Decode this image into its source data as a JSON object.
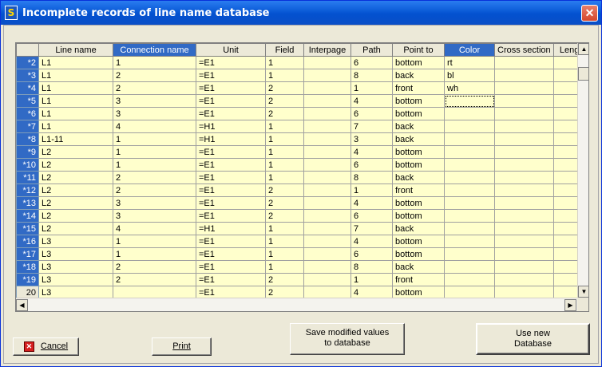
{
  "window": {
    "title": "Incomplete records of line name database",
    "icon": "app-icon",
    "close_icon": "close-icon"
  },
  "grid": {
    "columns": [
      "Line name",
      "Connection name",
      "Unit",
      "Field",
      "Interpage",
      "Path",
      "Point to",
      "Color",
      "Cross section",
      "Leng"
    ],
    "selected_columns": [
      1,
      7
    ],
    "rows": [
      {
        "num": "*2",
        "selected": true,
        "cells": [
          "L1",
          "1",
          "=E1",
          "1",
          "",
          "6",
          "bottom",
          "rt",
          "",
          ""
        ]
      },
      {
        "num": "*3",
        "selected": true,
        "cells": [
          "L1",
          "2",
          "=E1",
          "1",
          "",
          "8",
          "back",
          "bl",
          "",
          ""
        ]
      },
      {
        "num": "*4",
        "selected": true,
        "cells": [
          "L1",
          "2",
          "=E1",
          "2",
          "",
          "1",
          "front",
          "wh",
          "",
          ""
        ]
      },
      {
        "num": "*5",
        "selected": true,
        "cells": [
          "L1",
          "3",
          "=E1",
          "2",
          "",
          "4",
          "bottom",
          "",
          "",
          ""
        ]
      },
      {
        "num": "*6",
        "selected": true,
        "cells": [
          "L1",
          "3",
          "=E1",
          "2",
          "",
          "6",
          "bottom",
          "",
          "",
          ""
        ]
      },
      {
        "num": "*7",
        "selected": true,
        "cells": [
          "L1",
          "4",
          "=H1",
          "1",
          "",
          "7",
          "back",
          "",
          "",
          ""
        ]
      },
      {
        "num": "*8",
        "selected": true,
        "cells": [
          "L1-11",
          "1",
          "=H1",
          "1",
          "",
          "3",
          "back",
          "",
          "",
          ""
        ]
      },
      {
        "num": "*9",
        "selected": true,
        "cells": [
          "L2",
          "1",
          "=E1",
          "1",
          "",
          "4",
          "bottom",
          "",
          "",
          ""
        ]
      },
      {
        "num": "*10",
        "selected": true,
        "cells": [
          "L2",
          "1",
          "=E1",
          "1",
          "",
          "6",
          "bottom",
          "",
          "",
          ""
        ]
      },
      {
        "num": "*11",
        "selected": true,
        "cells": [
          "L2",
          "2",
          "=E1",
          "1",
          "",
          "8",
          "back",
          "",
          "",
          ""
        ]
      },
      {
        "num": "*12",
        "selected": true,
        "cells": [
          "L2",
          "2",
          "=E1",
          "2",
          "",
          "1",
          "front",
          "",
          "",
          ""
        ]
      },
      {
        "num": "*13",
        "selected": true,
        "cells": [
          "L2",
          "3",
          "=E1",
          "2",
          "",
          "4",
          "bottom",
          "",
          "",
          ""
        ]
      },
      {
        "num": "*14",
        "selected": true,
        "cells": [
          "L2",
          "3",
          "=E1",
          "2",
          "",
          "6",
          "bottom",
          "",
          "",
          ""
        ]
      },
      {
        "num": "*15",
        "selected": true,
        "cells": [
          "L2",
          "4",
          "=H1",
          "1",
          "",
          "7",
          "back",
          "",
          "",
          ""
        ]
      },
      {
        "num": "*16",
        "selected": true,
        "cells": [
          "L3",
          "1",
          "=E1",
          "1",
          "",
          "4",
          "bottom",
          "",
          "",
          ""
        ]
      },
      {
        "num": "*17",
        "selected": true,
        "cells": [
          "L3",
          "1",
          "=E1",
          "1",
          "",
          "6",
          "bottom",
          "",
          "",
          ""
        ]
      },
      {
        "num": "*18",
        "selected": true,
        "cells": [
          "L3",
          "2",
          "=E1",
          "1",
          "",
          "8",
          "back",
          "",
          "",
          ""
        ]
      },
      {
        "num": "*19",
        "selected": true,
        "cells": [
          "L3",
          "2",
          "=E1",
          "2",
          "",
          "1",
          "front",
          "",
          "",
          ""
        ]
      },
      {
        "num": "20",
        "selected": false,
        "cells": [
          "L3",
          "",
          "=E1",
          "2",
          "",
          "4",
          "bottom",
          "",
          "",
          ""
        ]
      }
    ],
    "focused_cell": {
      "row": 3,
      "col": 7
    }
  },
  "buttons": {
    "cancel": "Cancel",
    "print": "Print",
    "save_line1": "Save modified values",
    "save_line2": "to database",
    "use_new_line1": "Use new",
    "use_new_line2": "Database"
  },
  "colors": {
    "selection": "#316ac5",
    "cell_bg": "#ffffcc",
    "title_bar": "#0a5ad6"
  }
}
